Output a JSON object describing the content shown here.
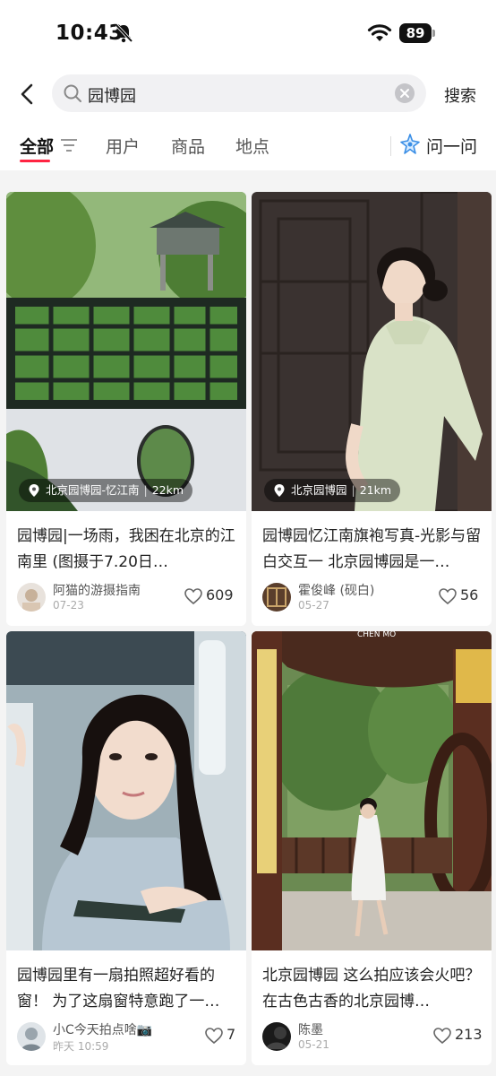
{
  "status_bar": {
    "time": "10:43",
    "battery": "89"
  },
  "search": {
    "query": "园博园",
    "button_label": "搜索"
  },
  "tabs": {
    "items": [
      "全部",
      "用户",
      "商品",
      "地点"
    ],
    "ask_label": "问一问"
  },
  "accent_color": "#ff2442",
  "cards": [
    {
      "location": "北京园博园-忆江南",
      "distance": "22km",
      "title": "园博园|一场雨，我困在北京的江南里 (图摄于7.20日…",
      "author": "阿猫的游摄指南",
      "date": "07-23",
      "likes": "609"
    },
    {
      "location": "北京园博园",
      "distance": "21km",
      "title": "园博园忆江南旗袍写真-光影与留白交互一 北京园博园是一…",
      "author": "霍俊峰 (砚白)",
      "date": "05-27",
      "likes": "56"
    },
    {
      "title": "园博园里有一扇拍照超好看的窗！ 为了这扇窗特意跑了一…",
      "author": "小C今天拍点啥📷",
      "date": "昨天 10:59",
      "likes": "7"
    },
    {
      "title": "北京园博园 这么拍应该会火吧？ 在古色古香的北京园博…",
      "author": "陈墨",
      "date": "05-21",
      "likes": "213",
      "image_caption": "CHEN MO"
    }
  ]
}
